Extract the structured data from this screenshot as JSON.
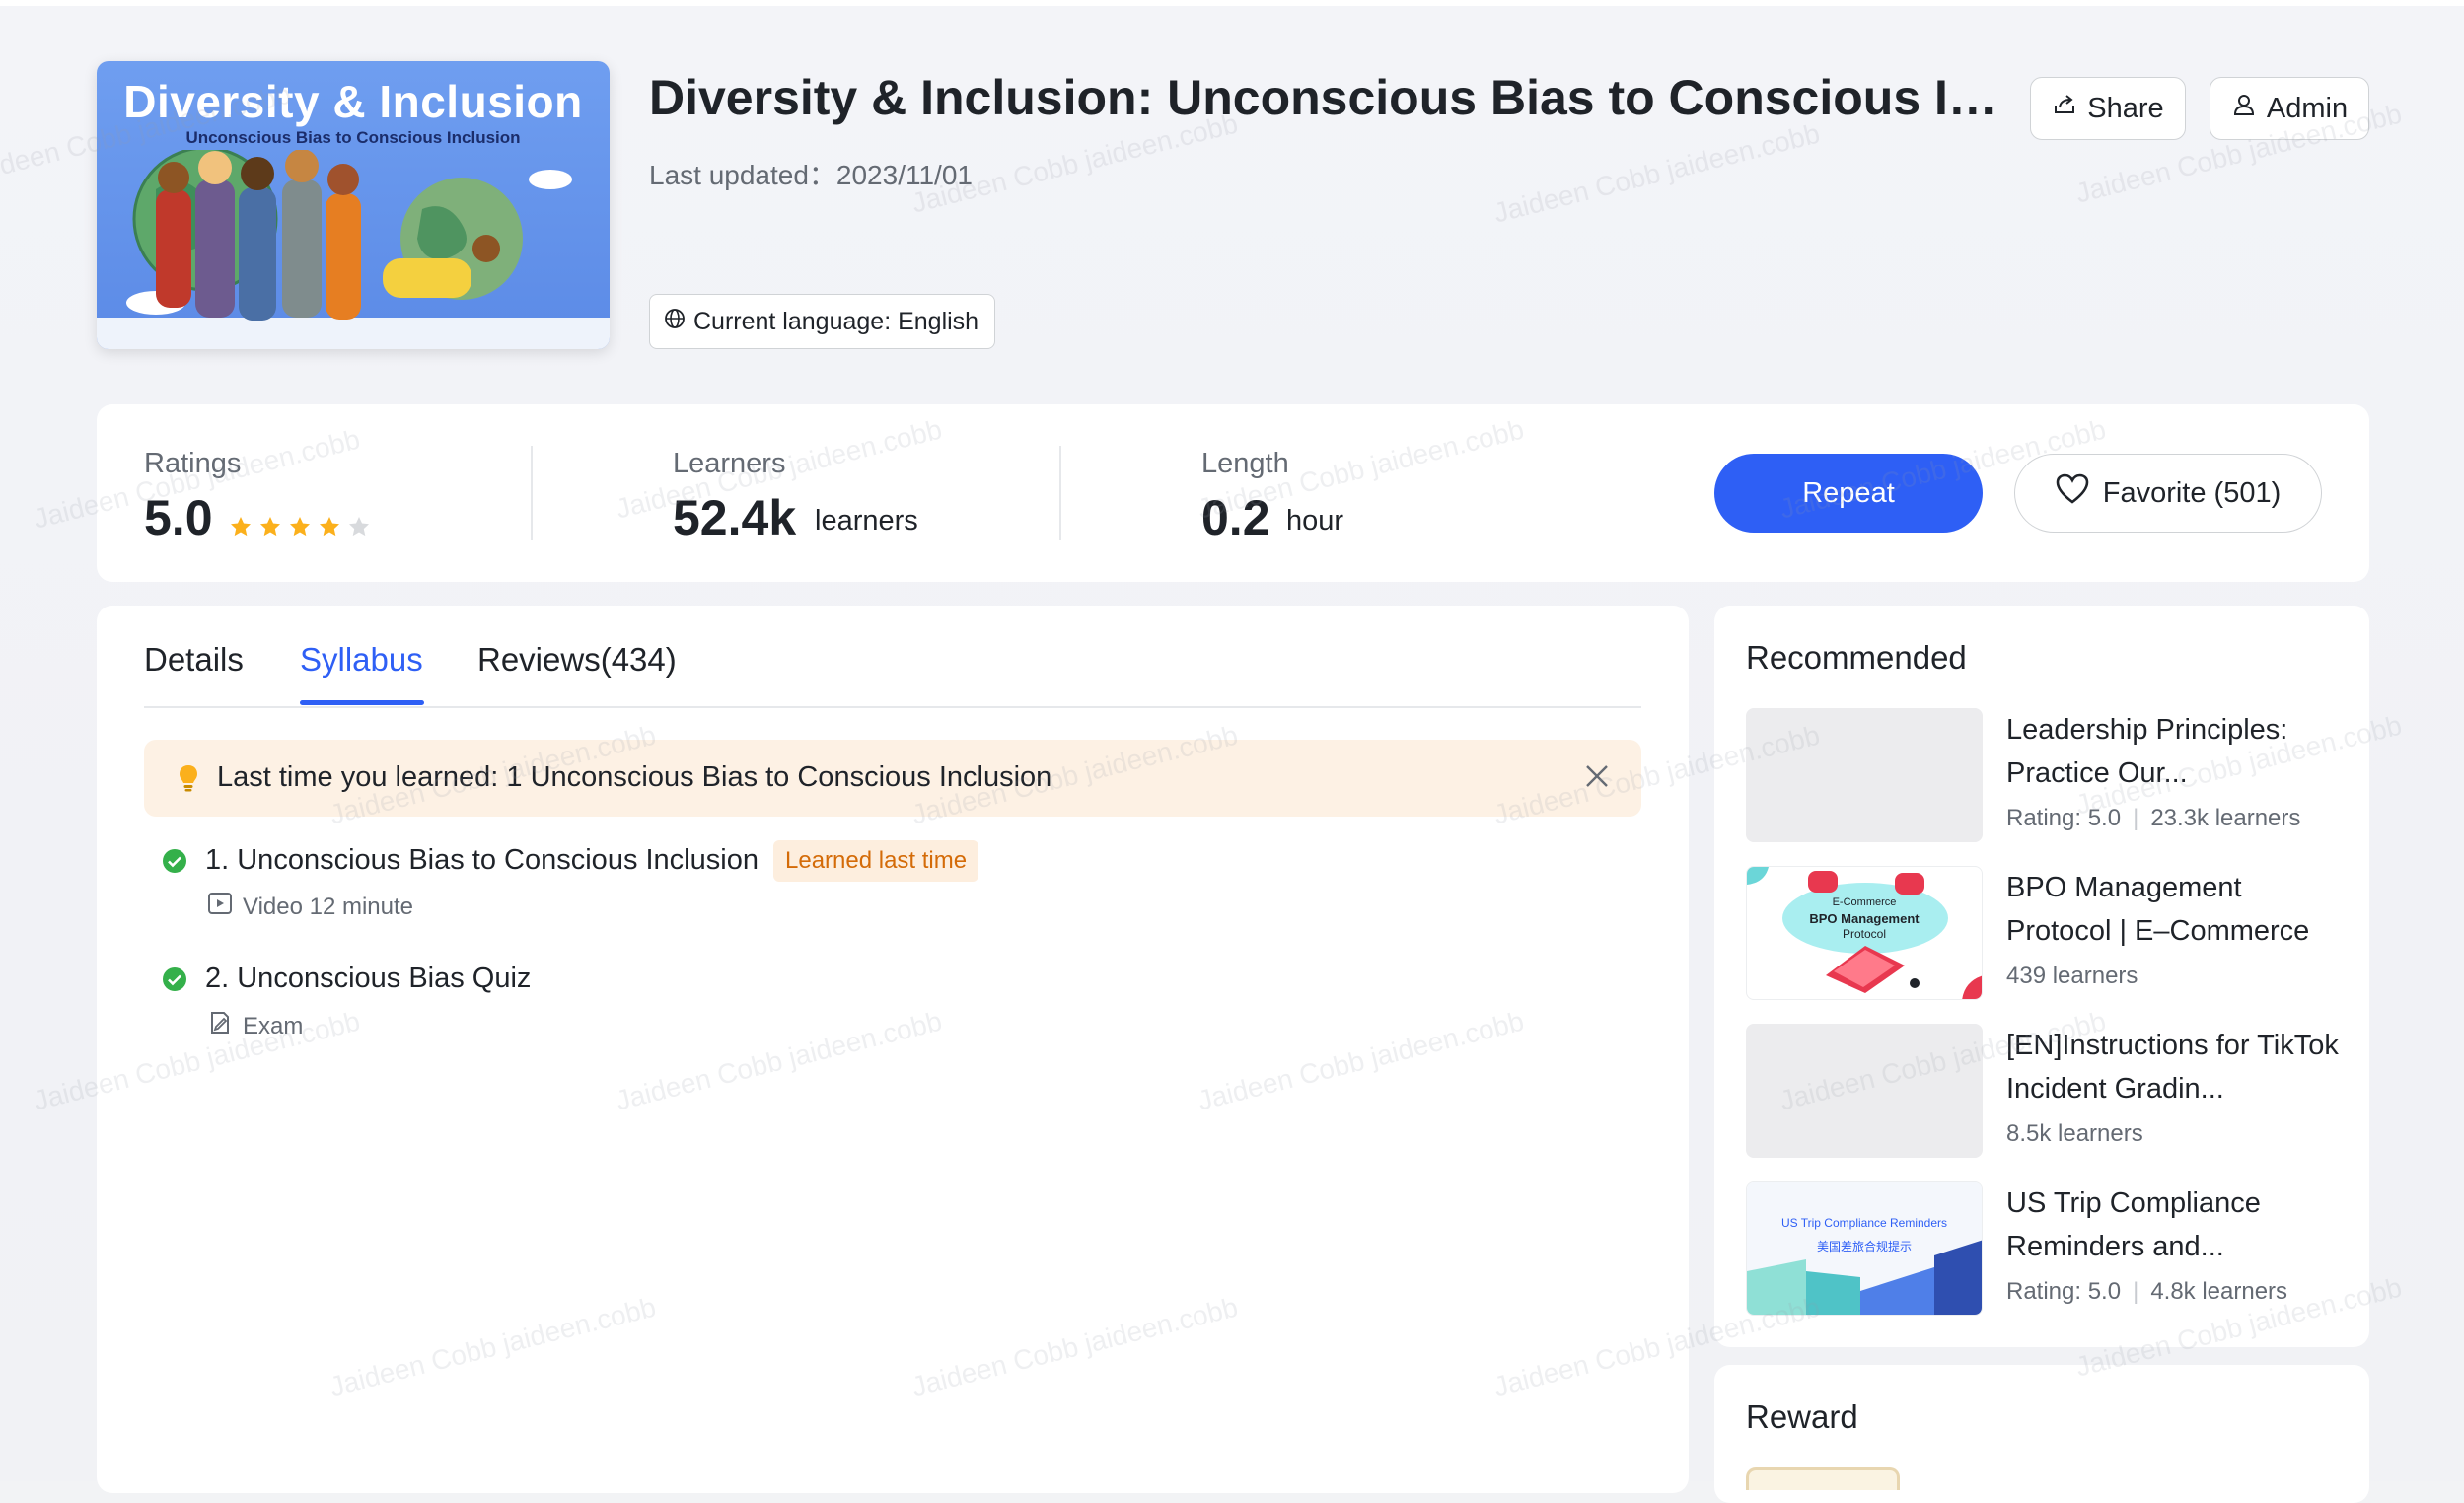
{
  "course": {
    "cover_title": "Diversity & Inclusion",
    "cover_subtitle": "Unconscious Bias to Conscious Inclusion",
    "title": "Diversity & Inclusion: Unconscious Bias to Conscious Incl...",
    "last_updated": "Last updated：2023/11/01",
    "language": "Current language: English"
  },
  "header_buttons": {
    "share": "Share",
    "admin": "Admin"
  },
  "stats": {
    "ratings_label": "Ratings",
    "ratings_value": "5.0",
    "stars_filled": 4,
    "stars_total": 5,
    "learners_label": "Learners",
    "learners_value": "52.4k",
    "learners_unit": "learners",
    "length_label": "Length",
    "length_value": "0.2",
    "length_unit": "hour"
  },
  "actions": {
    "repeat": "Repeat",
    "favorite": "Favorite (501)"
  },
  "tabs": [
    {
      "label": "Details",
      "active": false
    },
    {
      "label": "Syllabus",
      "active": true
    },
    {
      "label": "Reviews(434)",
      "active": false
    }
  ],
  "banner": {
    "text": "Last time you learned: 1 Unconscious Bias to Conscious Inclusion"
  },
  "lessons": [
    {
      "title": "1. Unconscious Bias to Conscious Inclusion",
      "badge": "Learned last time",
      "meta": "Video 12 minute"
    },
    {
      "title": "2. Unconscious Bias Quiz",
      "meta": "Exam"
    }
  ],
  "recommended": {
    "heading": "Recommended",
    "items": [
      {
        "title": "Leadership Principles: Practice Our...",
        "rating": "Rating:  5.0",
        "learners": "23.3k learners"
      },
      {
        "title": "BPO Management Protocol | E–Commerce",
        "learners": "439 learners",
        "thumb_text_1": "E-Commerce",
        "thumb_text_2": "BPO Management",
        "thumb_text_3": "Protocol"
      },
      {
        "title": "[EN]Instructions for TikTok Incident Gradin...",
        "learners": "8.5k learners"
      },
      {
        "title": "US Trip Compliance Reminders and...",
        "rating": "Rating:  5.0",
        "learners": "4.8k learners",
        "thumb_text_1": "US Trip Compliance Reminders",
        "thumb_text_2": "美国差旅合规提示"
      }
    ]
  },
  "reward": {
    "heading": "Reward"
  },
  "watermark": "Jaideen Cobb jaideen.cobb",
  "colors": {
    "primary": "#2e5ff5",
    "star": "#fbb01c",
    "success": "#34b04a",
    "banner_bg": "#fdf1e4",
    "badge_text": "#d46b08"
  }
}
